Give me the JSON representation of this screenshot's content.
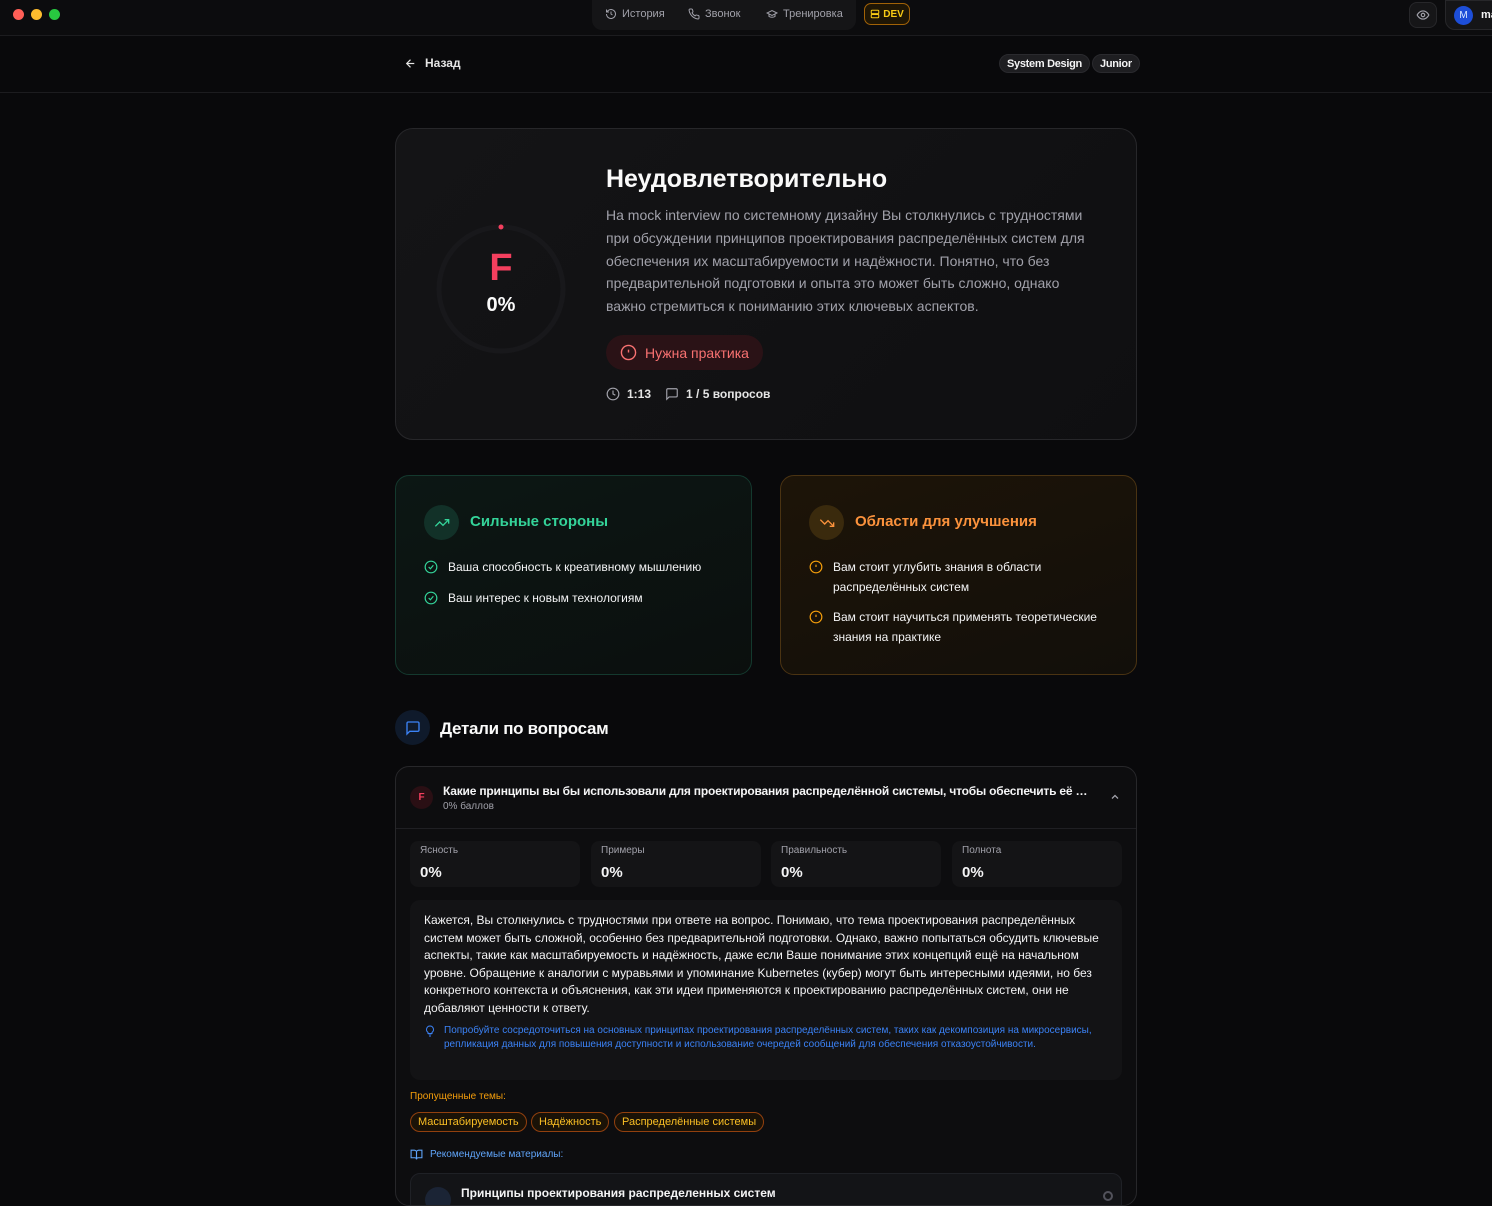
{
  "topbar": {
    "nav": [
      {
        "label": "История",
        "icon": "history-icon"
      },
      {
        "label": "Звонок",
        "icon": "phone-icon"
      },
      {
        "label": "Тренировка",
        "icon": "graduation-cap-icon"
      }
    ],
    "dev_label": "DEV",
    "user_initial": "M",
    "user_name": "ma"
  },
  "header": {
    "back_label": "Назад",
    "tags": [
      "System Design",
      "Junior"
    ]
  },
  "result": {
    "grade": "F",
    "score_percent": "0%",
    "score_value": 0,
    "title": "Неудовлетворительно",
    "description": "На mock interview по системному дизайну Вы столкнулись с трудностями при обсуждении принципов проектирования распределённых систем для обеспечения их масштабируемости и надёжности. Понятно, что без предварительной подготовки и опыта это может быть сложно, однако важно стремиться к пониманию этих ключевых аспектов.",
    "badge": "Нужна практика",
    "duration": "1:13",
    "questions": "1 / 5 вопросов"
  },
  "strengths": {
    "title": "Сильные стороны",
    "items": [
      "Ваша способность к креативному мышлению",
      "Ваш интерес к новым технологиям"
    ]
  },
  "improvements": {
    "title": "Области для улучшения",
    "items": [
      "Вам стоит углубить знания в области распределённых систем",
      "Вам стоит научиться применять теоретические знания на практике"
    ]
  },
  "details": {
    "title": "Детали по вопросам",
    "question": {
      "grade": "F",
      "title": "Какие принципы вы бы использовали для проектирования распределённой системы, чтобы обеспечить её масштабируемость и надёжность?",
      "score": "0% баллов",
      "metrics": [
        {
          "label": "Ясность",
          "value": "0%"
        },
        {
          "label": "Примеры",
          "value": "0%"
        },
        {
          "label": "Правильность",
          "value": "0%"
        },
        {
          "label": "Полнота",
          "value": "0%"
        }
      ],
      "feedback": "Кажется, Вы столкнулись с трудностями при ответе на вопрос. Понимаю, что тема проектирования распределённых систем может быть сложной, особенно без предварительной подготовки. Однако, важно попытаться обсудить ключевые аспекты, такие как масштабируемость и надёжность, даже если Ваше понимание этих концепций ещё на начальном уровне. Обращение к аналогии с муравьями и упоминание Kubernetes (кубер) могут быть интересными идеями, но без конкретного контекста и объяснения, как эти идеи применяются к проектированию распределённых систем, они не добавляют ценности к ответу.",
      "tip": "Попробуйте сосредоточиться на основных принципах проектирования распределённых систем, таких как декомпозиция на микросервисы, репликация данных для повышения доступности и использование очередей сообщений для обеспечения отказоустойчивости.",
      "missed_label": "Пропущенные темы:",
      "missed_topics": [
        "Масштабируемость",
        "Надёжность",
        "Распределённые системы"
      ],
      "recommended_label": "Рекомендуемые материалы:",
      "recommended": [
        {
          "title": "Принципы проектирования распределенных систем"
        }
      ]
    }
  },
  "colors": {
    "accent_red": "#f43f5e",
    "success": "#34d399",
    "warning": "#fb923c",
    "info": "#3b82f6"
  }
}
